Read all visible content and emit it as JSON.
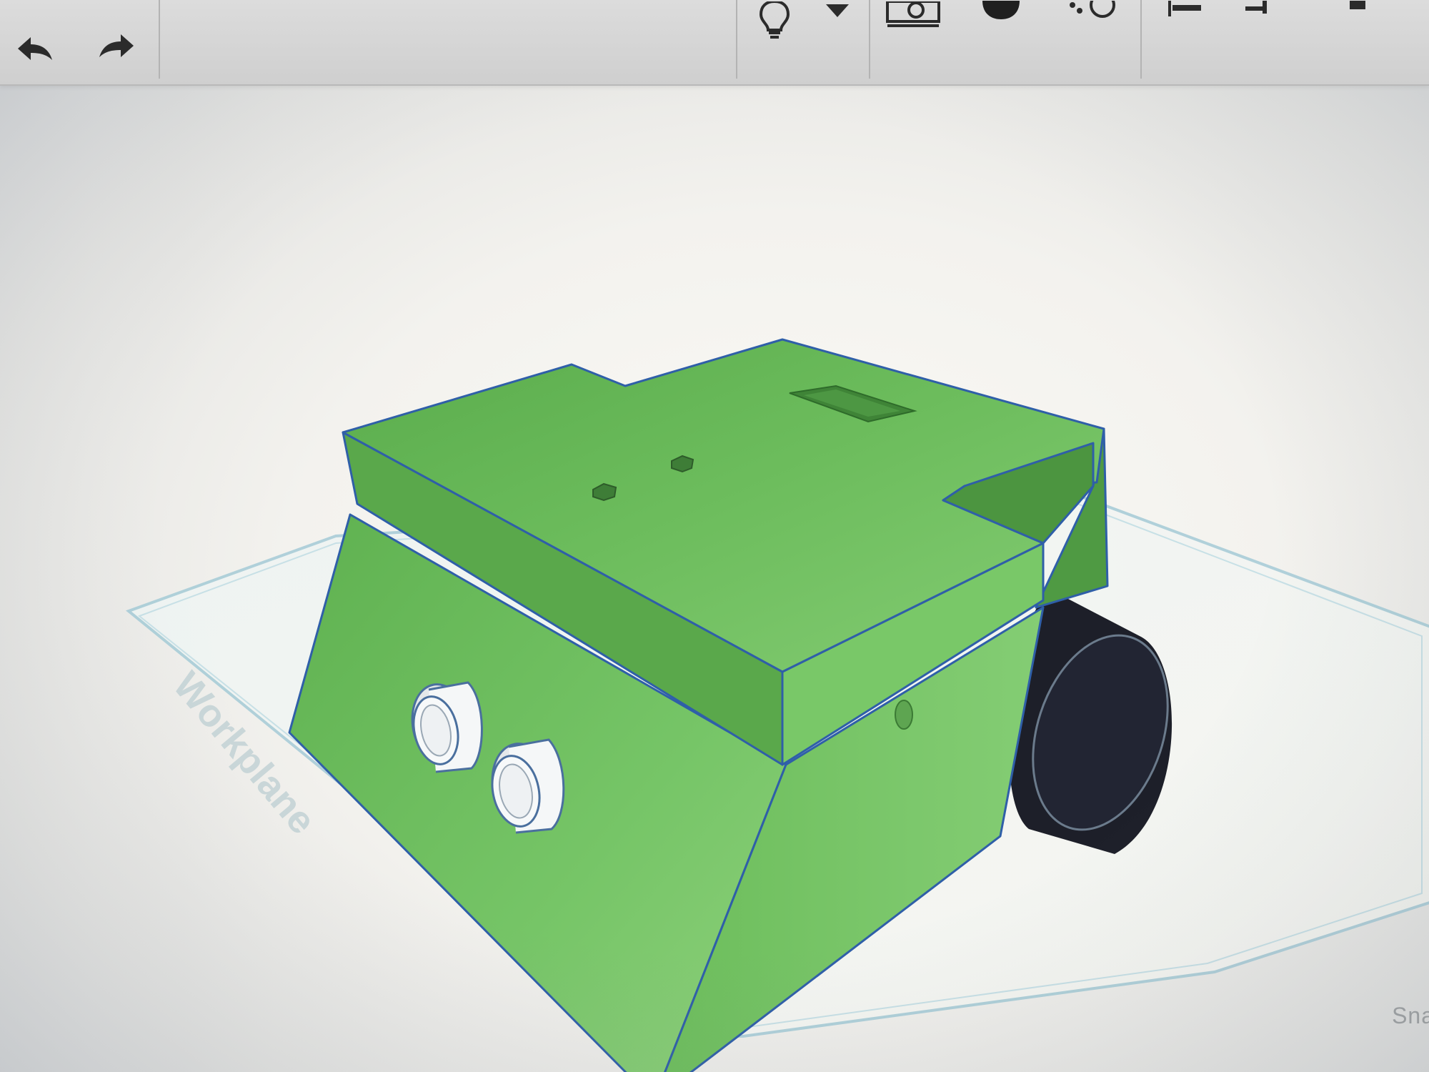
{
  "toolbar": {
    "undo_icon": "undo-arrow-icon",
    "redo_icon": "redo-arrow-icon",
    "view_tools": [
      "lightbulb-icon",
      "dropdown-caret-icon",
      "camera-view-icon",
      "shape-solid-icon",
      "hole-icon",
      "align-icon",
      "mirror-icon"
    ]
  },
  "workplane": {
    "label": "Workplane",
    "snap_label": "Sna"
  },
  "model": {
    "body_color": "#6aba5a",
    "top_color": "#79c766",
    "edge_color": "#2f5fa8",
    "wheel_color": "#1c1f2a",
    "sensor_color": "#f4f6f8"
  }
}
